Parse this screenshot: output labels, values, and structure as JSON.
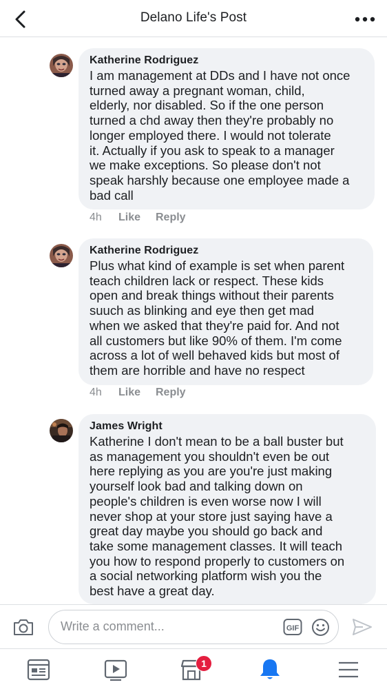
{
  "header": {
    "title": "Delano Life's Post"
  },
  "comments": [
    {
      "author": "Katherine Rodriguez",
      "text": "I am management at DDs and I have not once\nturned away a pregnant woman, child,\nelderly,  nor disabled. So if the one person\nturned a chd away then they're probably no\nlonger employed there.  I would not tolerate\nit. Actually if you ask to speak to a manager\nwe make exceptions. So please don't not\nspeak harshly because one employee made a\nbad call",
      "time": "4h",
      "like_label": "Like",
      "reply_label": "Reply"
    },
    {
      "author": "Katherine Rodriguez",
      "text": "Plus what kind of example is set when parent\nteach children lack or respect.  These kids\nopen and break things without their parents\nsuuch as blinking and eye then get mad\nwhen we asked that they're paid for.  And not\nall customers but like 90% of them. I'm come\nacross a lot of well behaved kids but most of\nthem are horrible and have no respect",
      "time": "4h",
      "like_label": "Like",
      "reply_label": "Reply"
    },
    {
      "author": "James Wright",
      "text": "Katherine I don't mean to be a ball buster but\nas management you shouldn't even be out\nhere replying as you are you're just making\nyourself look bad and talking down on\npeople's children is even worse now I will\nnever shop at your store just saying have a\ngreat day maybe you should go back and\ntake some management classes. It will teach\nyou how to respond properly to customers on\na social networking platform wish you the\nbest have a great day."
    }
  ],
  "composer": {
    "placeholder": "Write a comment...",
    "gif_label": "GIF"
  },
  "tabbar": {
    "marketplace_badge": "1",
    "active_tab": "notifications",
    "accent_color": "#1877f2"
  },
  "colors": {
    "bubble": "#f0f2f5",
    "meta_text": "#8a8d91",
    "badge": "#e41e3f"
  }
}
